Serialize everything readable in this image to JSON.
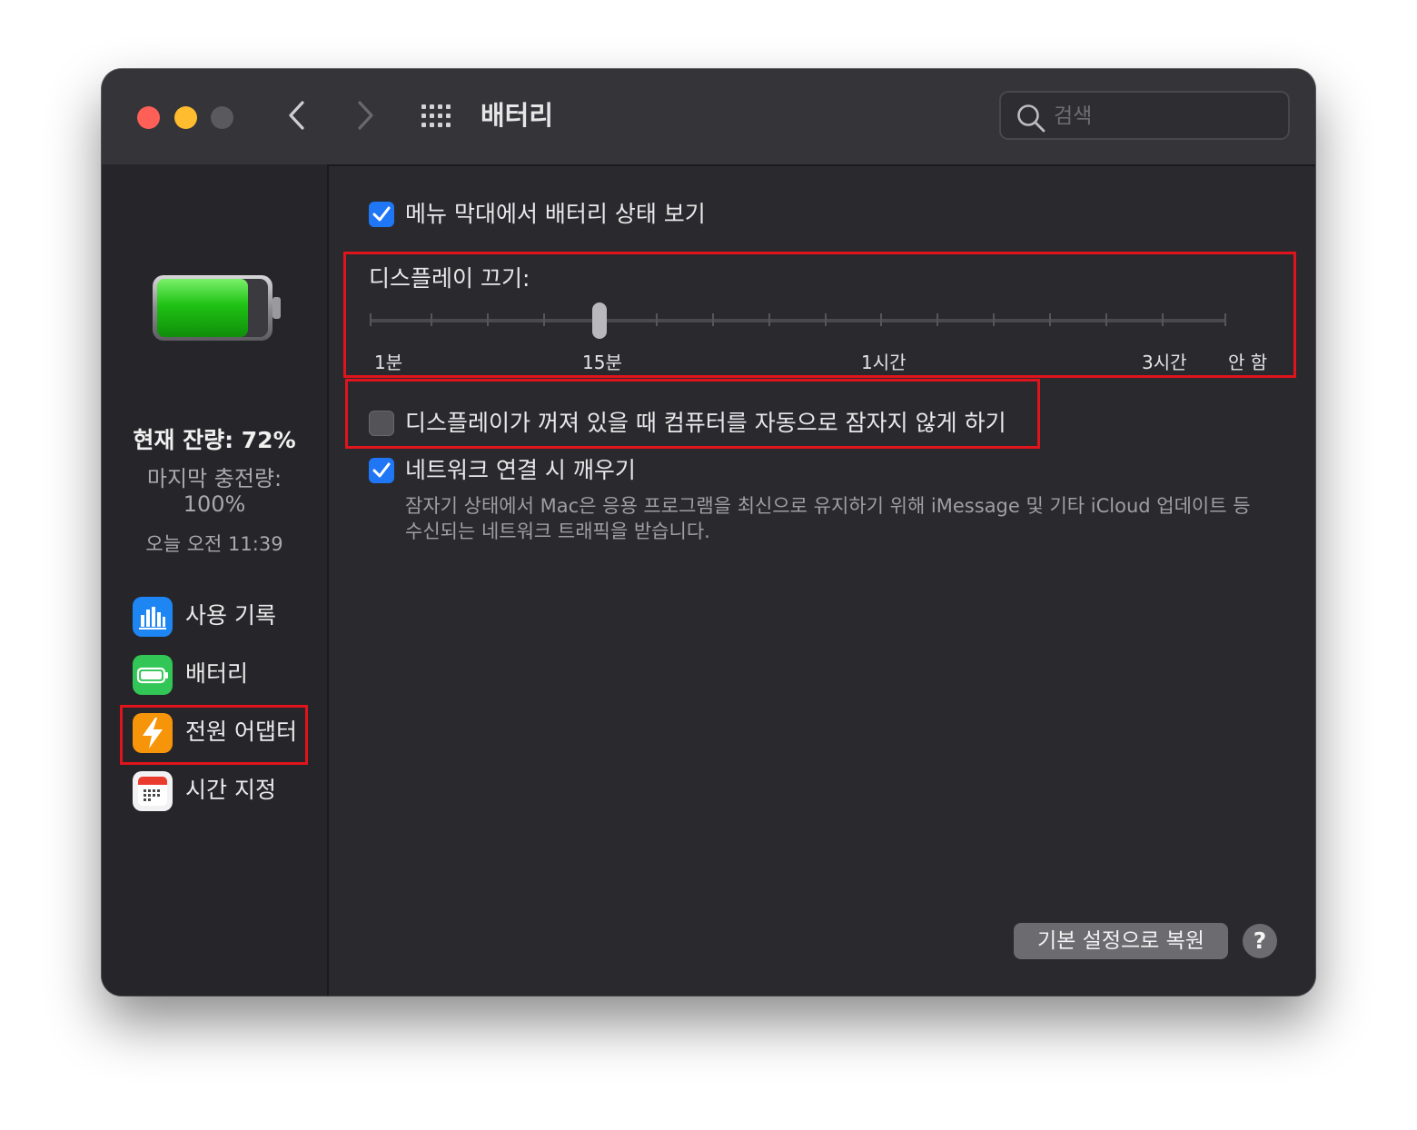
{
  "window": {
    "title": "배터리",
    "search_placeholder": "검색"
  },
  "sidebar": {
    "battery_level": "현재 잔량: 72%",
    "last_charge_label": "마지막 충전량:",
    "last_charge_value": "100%",
    "last_charge_time": "오늘 오전 11:39",
    "items": [
      {
        "label": "사용 기록",
        "icon": "chart-bars-icon"
      },
      {
        "label": "배터리",
        "icon": "battery-icon"
      },
      {
        "label": "전원 어댑터",
        "icon": "lightning-bolt-icon"
      },
      {
        "label": "시간 지정",
        "icon": "calendar-icon"
      }
    ],
    "selected_index": 2
  },
  "main": {
    "show_battery_status": {
      "label": "메뉴 막대에서 배터리 상태 보기",
      "checked": true
    },
    "display_off": {
      "label": "디스플레이 끄기:",
      "tick_labels": [
        "1분",
        "15분",
        "1시간",
        "3시간",
        "안 함"
      ],
      "value": "15분"
    },
    "prevent_sleep": {
      "label": "디스플레이가 꺼져 있을 때 컴퓨터를 자동으로 잠자지 않게 하기",
      "checked": false
    },
    "wake_network": {
      "label": "네트워크 연결 시 깨우기",
      "checked": true,
      "description_line1": "잠자기 상태에서 Mac은 응용 프로그램을 최신으로 유지하기 위해 iMessage 및 기타 iCloud 업데이트 등",
      "description_line2": "수신되는 네트워크 트래픽을 받습니다."
    }
  },
  "footer": {
    "restore_defaults": "기본 설정으로 복원",
    "help": "?"
  },
  "colors": {
    "highlight_box": "#e0141c",
    "checkbox_on": "#1f77f5",
    "battery_green": "#22c21a"
  }
}
